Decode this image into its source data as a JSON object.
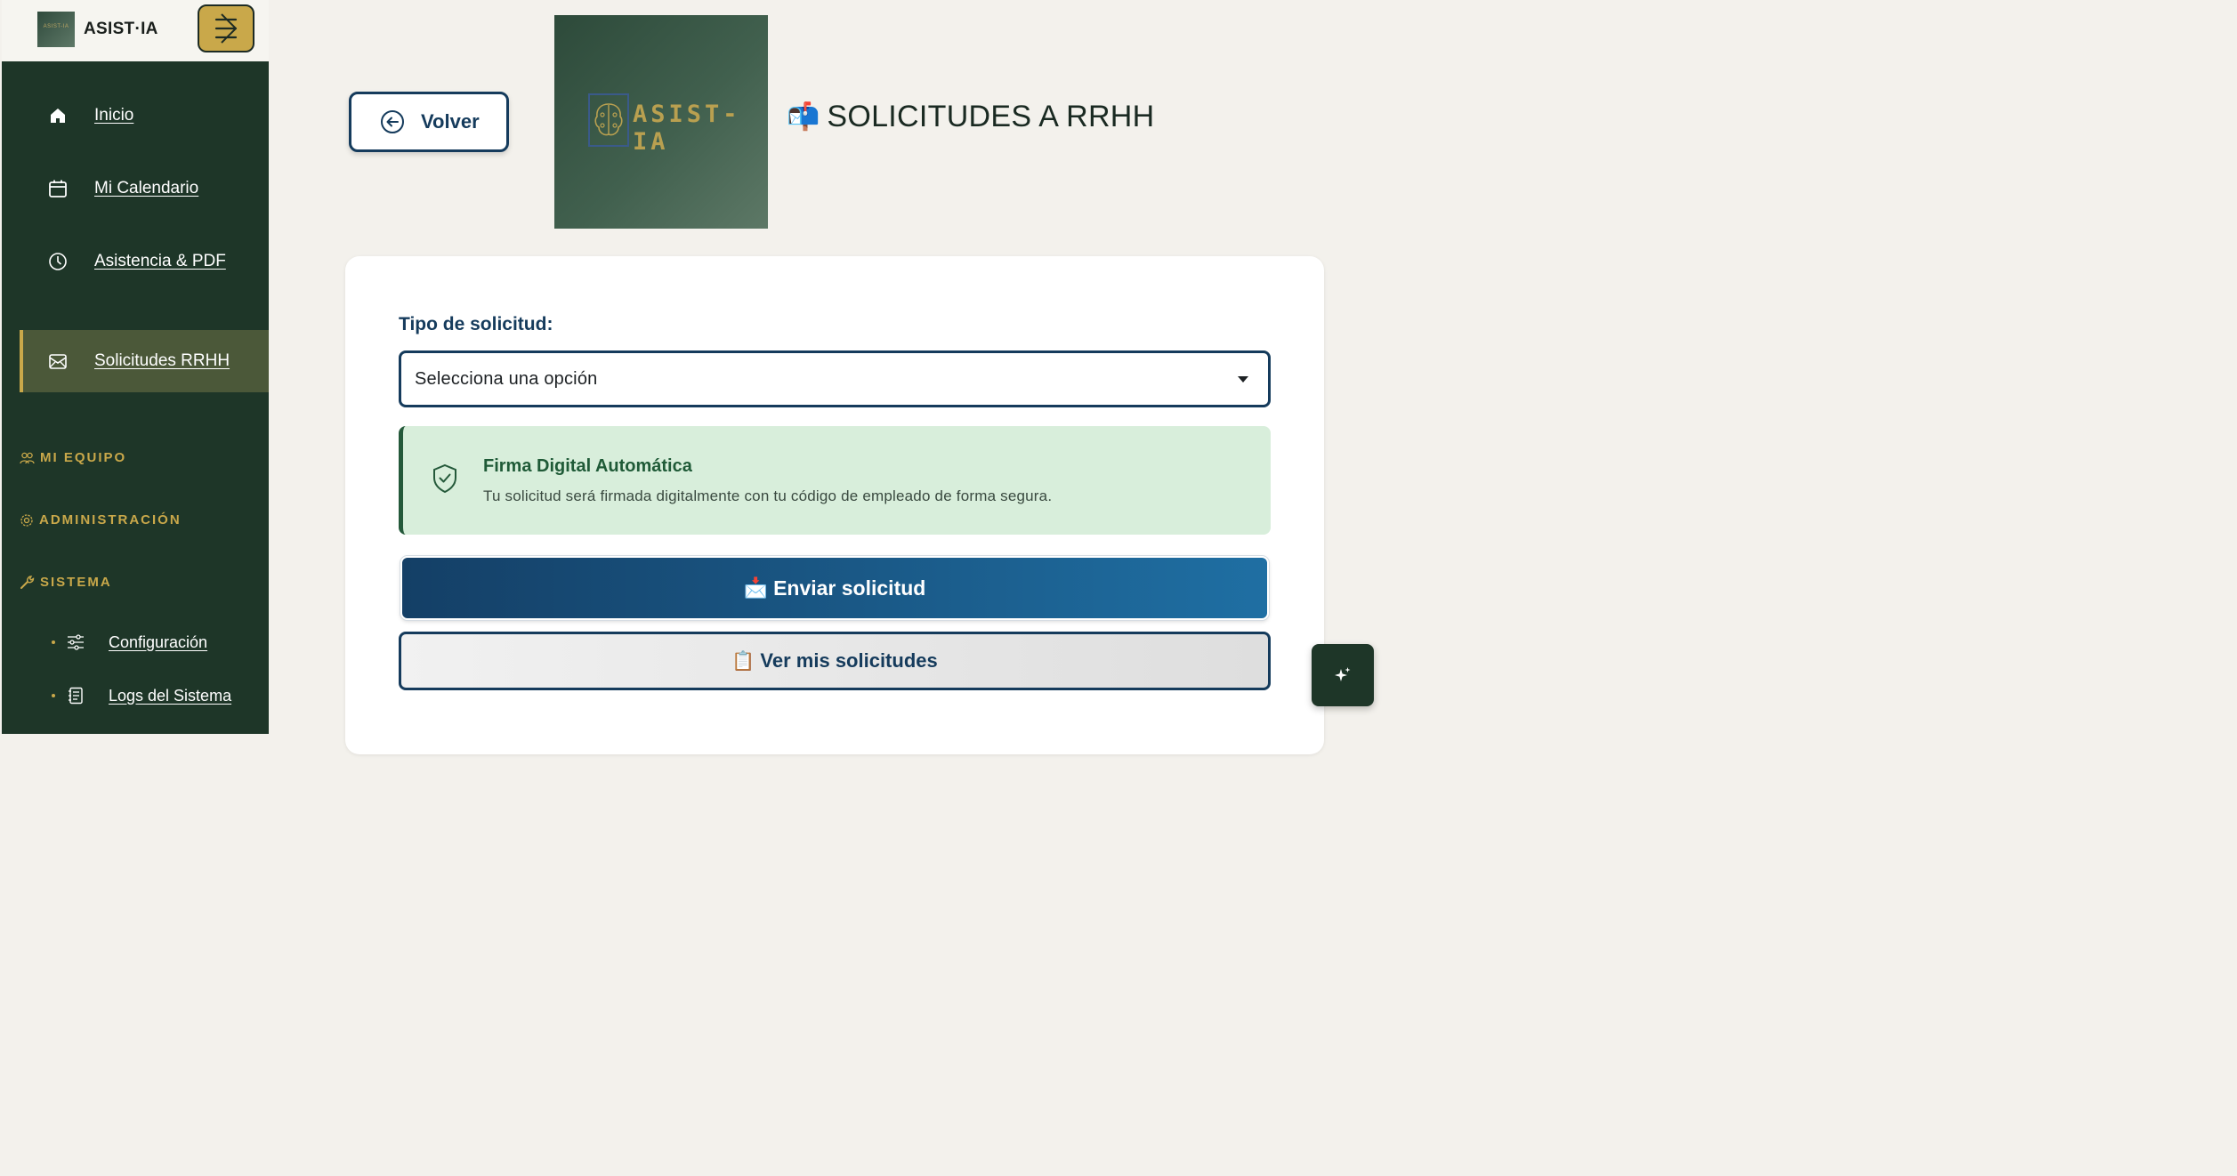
{
  "app": {
    "name": "ASIST·IA",
    "logo_text": "ASIST-IA"
  },
  "sidebar": {
    "nav": [
      {
        "label": "Inicio",
        "icon": "home-icon"
      },
      {
        "label": "Mi Calendario",
        "icon": "calendar-icon"
      },
      {
        "label": "Asistencia & PDF",
        "icon": "clock-icon"
      },
      {
        "label": "Solicitudes RRHH",
        "icon": "inbox-icon",
        "active": true
      }
    ],
    "sections": [
      {
        "label": "MI EQUIPO",
        "icon": "users-icon"
      },
      {
        "label": "ADMINISTRACIÓN",
        "icon": "gear-icon"
      },
      {
        "label": "SISTEMA",
        "icon": "wrench-icon"
      }
    ],
    "system_items": [
      {
        "label": "Configuración",
        "icon": "sliders-icon"
      },
      {
        "label": "Logs del Sistema",
        "icon": "log-icon"
      }
    ]
  },
  "header": {
    "back_label": "Volver",
    "title_emoji": "📬",
    "title": "SOLICITUDES A RRHH"
  },
  "form": {
    "type_label": "Tipo de solicitud:",
    "select_value": "Selecciona una opción",
    "info_title": "Firma Digital Automática",
    "info_text": "Tu solicitud será firmada digitalmente con tu código de empleado de forma segura.",
    "submit_emoji": "📩",
    "submit_label": "Enviar solicitud",
    "view_emoji": "📋",
    "view_label": "Ver mis solicitudes"
  },
  "colors": {
    "sidebar_bg": "#1e3628",
    "accent_gold": "#c9a84a",
    "primary_blue": "#153b5c",
    "info_bg": "#d8eedb"
  }
}
